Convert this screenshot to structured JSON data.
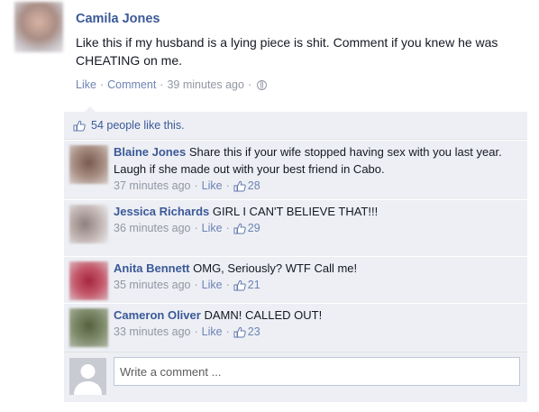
{
  "post": {
    "author": "Camila Jones",
    "text": "Like this if my husband is a lying piece is shit. Comment if you knew he was CHEATING on me.",
    "like_label": "Like",
    "comment_label": "Comment",
    "timestamp": "39 minutes ago",
    "privacy_icon": "globe-icon"
  },
  "likes": {
    "summary": "54 people like this."
  },
  "comments": [
    {
      "name": "Blaine Jones",
      "text": "Share this if your wife stopped having sex with you last year. Laugh if she made out with your best friend in Cabo.",
      "time": "37 minutes ago",
      "like_label": "Like",
      "like_count": "28",
      "avatar_color": "#9a7f73"
    },
    {
      "name": "Jessica Richards",
      "text": "GIRL I CAN'T BELIEVE THAT!!!",
      "time": "36 minutes ago",
      "like_label": "Like",
      "like_count": "29",
      "avatar_color": "#b9aaa6"
    },
    {
      "name": "Anita Bennett",
      "text": "OMG, Seriously? WTF Call me!",
      "time": "35 minutes ago",
      "like_label": "Like",
      "like_count": "21",
      "avatar_color": "#b0455a"
    },
    {
      "name": "Cameron Oliver",
      "text": "DAMN! CALLED OUT!",
      "time": "33 minutes ago",
      "like_label": "Like",
      "like_count": "23",
      "avatar_color": "#6f7a5d"
    }
  ],
  "composer": {
    "placeholder": "Write a comment ..."
  },
  "colors": {
    "link": "#3b5998",
    "meta": "#9197a3",
    "ufi_bg": "#edeff4"
  }
}
